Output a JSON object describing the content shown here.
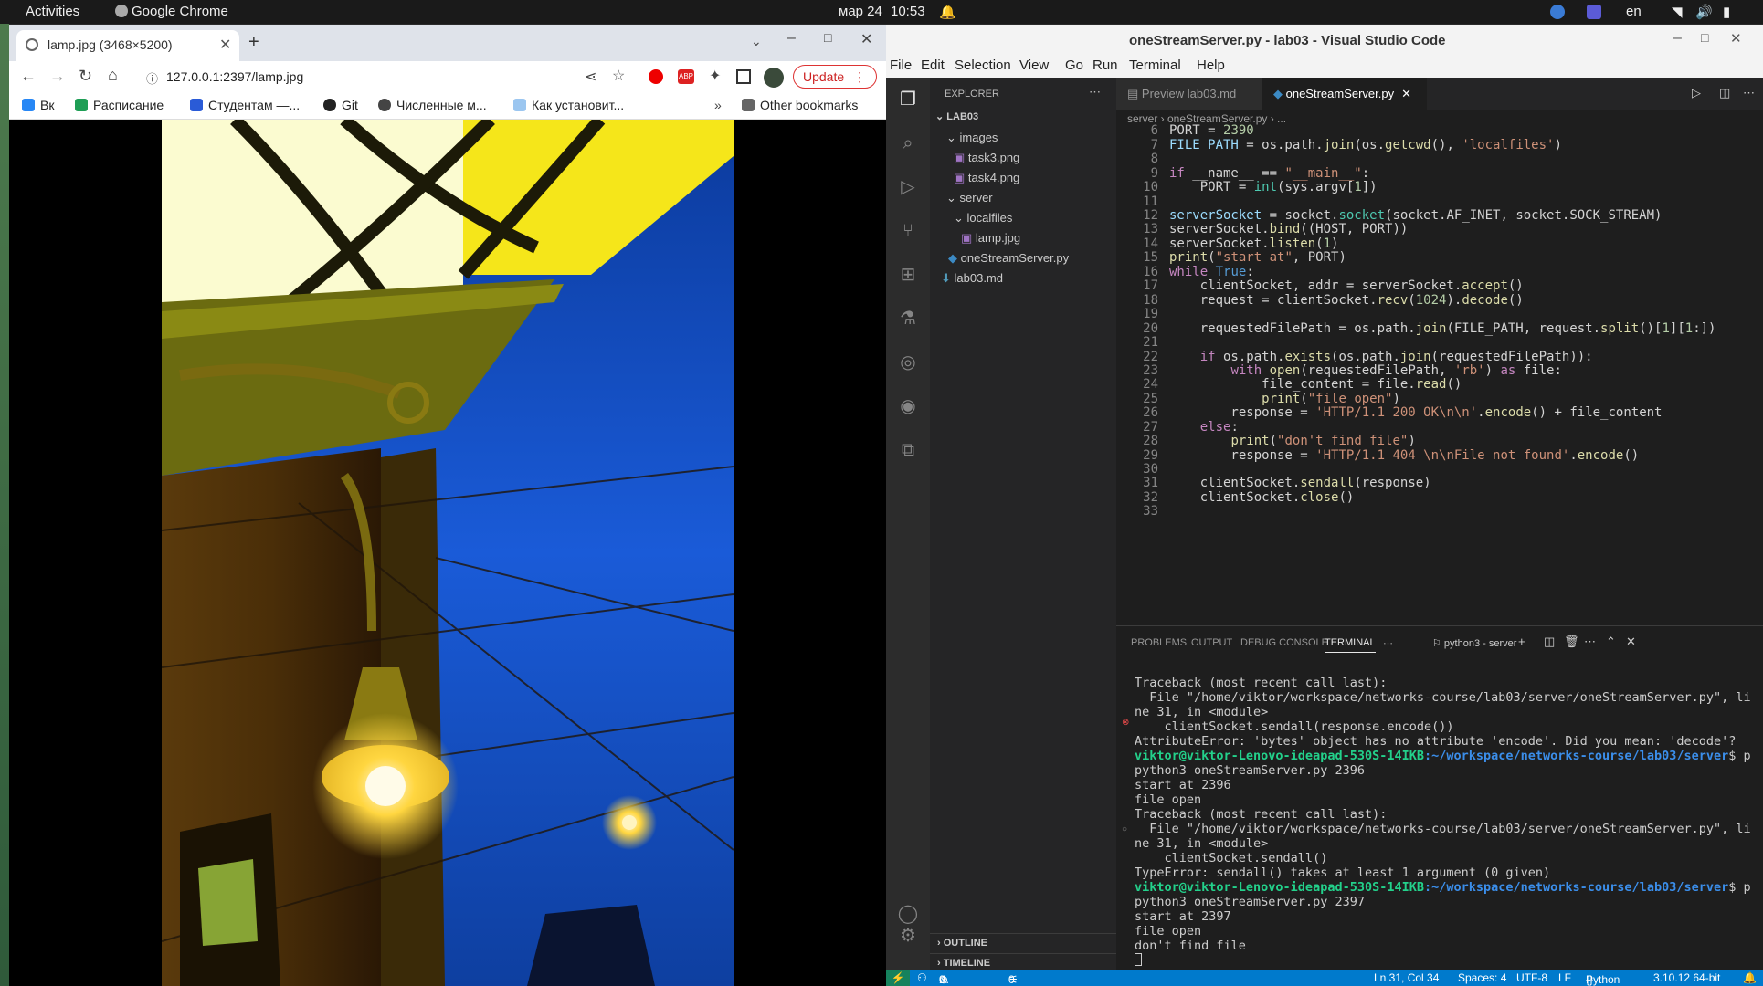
{
  "topbar": {
    "activities": "Activities",
    "app": "Google Chrome",
    "date": "мар 24",
    "time": "10:53",
    "lang": "en"
  },
  "chrome": {
    "tab_title": "lamp.jpg (3468×5200)",
    "url": "127.0.0.1:2397/lamp.jpg",
    "update_label": "Update",
    "bookmarks": [
      "Вк",
      "Расписание",
      "Студентам —...",
      "Git",
      "Численные м...",
      "Как установит...",
      "Other bookmarks"
    ]
  },
  "vscode": {
    "title": "oneStreamServer.py - lab03 - Visual Studio Code",
    "menu": [
      "File",
      "Edit",
      "Selection",
      "View",
      "Go",
      "Run",
      "Terminal",
      "Help"
    ],
    "explorer_label": "EXPLORER",
    "tree": [
      "LAB03",
      "images",
      "task3.png",
      "task4.png",
      "server",
      "localfiles",
      "lamp.jpg",
      "oneStreamServer.py",
      "lab03.md"
    ],
    "tabs": [
      "Preview lab03.md",
      "oneStreamServer.py"
    ],
    "breadcrumb": "server  ›  oneStreamServer.py  ›  ...",
    "line_numbers": [
      "6",
      "7",
      "8",
      "9",
      "10",
      "11",
      "12",
      "13",
      "14",
      "15",
      "16",
      "17",
      "18",
      "19",
      "20",
      "21",
      "22",
      "23",
      "24",
      "25",
      "26",
      "27",
      "28",
      "29",
      "30",
      "31",
      "32",
      "33"
    ],
    "panel_tabs": [
      "PROBLEMS",
      "OUTPUT",
      "DEBUG CONSOLE",
      "TERMINAL"
    ],
    "terminal_name": "python3 - server",
    "terminal_lines": [
      "Traceback (most recent call last):",
      "  File \"/home/viktor/workspace/networks-course/lab03/server/oneStreamServer.py\", li",
      "ne 31, in <module>",
      "    clientSocket.sendall(response.encode())",
      "AttributeError: 'bytes' object has no attribute 'encode'. Did you mean: 'decode'?",
      "python3 oneStreamServer.py 2396",
      "start at 2396",
      "file open",
      "Traceback (most recent call last):",
      "  File \"/home/viktor/workspace/networks-course/lab03/server/oneStreamServer.py\", li",
      "ne 31, in <module>",
      "    clientSocket.sendall()",
      "TypeError: sendall() takes at least 1 argument (0 given)",
      "python3 oneStreamServer.py 2397",
      "start at 2397",
      "file open",
      "don't find file"
    ],
    "prompt_user": "viktor@viktor-Lenovo-ideapad-530S-14IKB",
    "prompt_path": ":~/workspace/networks-course/lab03/server",
    "prompt_tail": "$ p",
    "outline_label": "OUTLINE",
    "timeline_label": "TIMELINE",
    "status": {
      "errors": "0",
      "warnings": "0",
      "ports": "0",
      "position": "Ln 31, Col 34",
      "spaces": "Spaces: 4",
      "encoding": "UTF-8",
      "eol": "LF",
      "language": "Python",
      "version": "3.10.12 64-bit"
    }
  }
}
